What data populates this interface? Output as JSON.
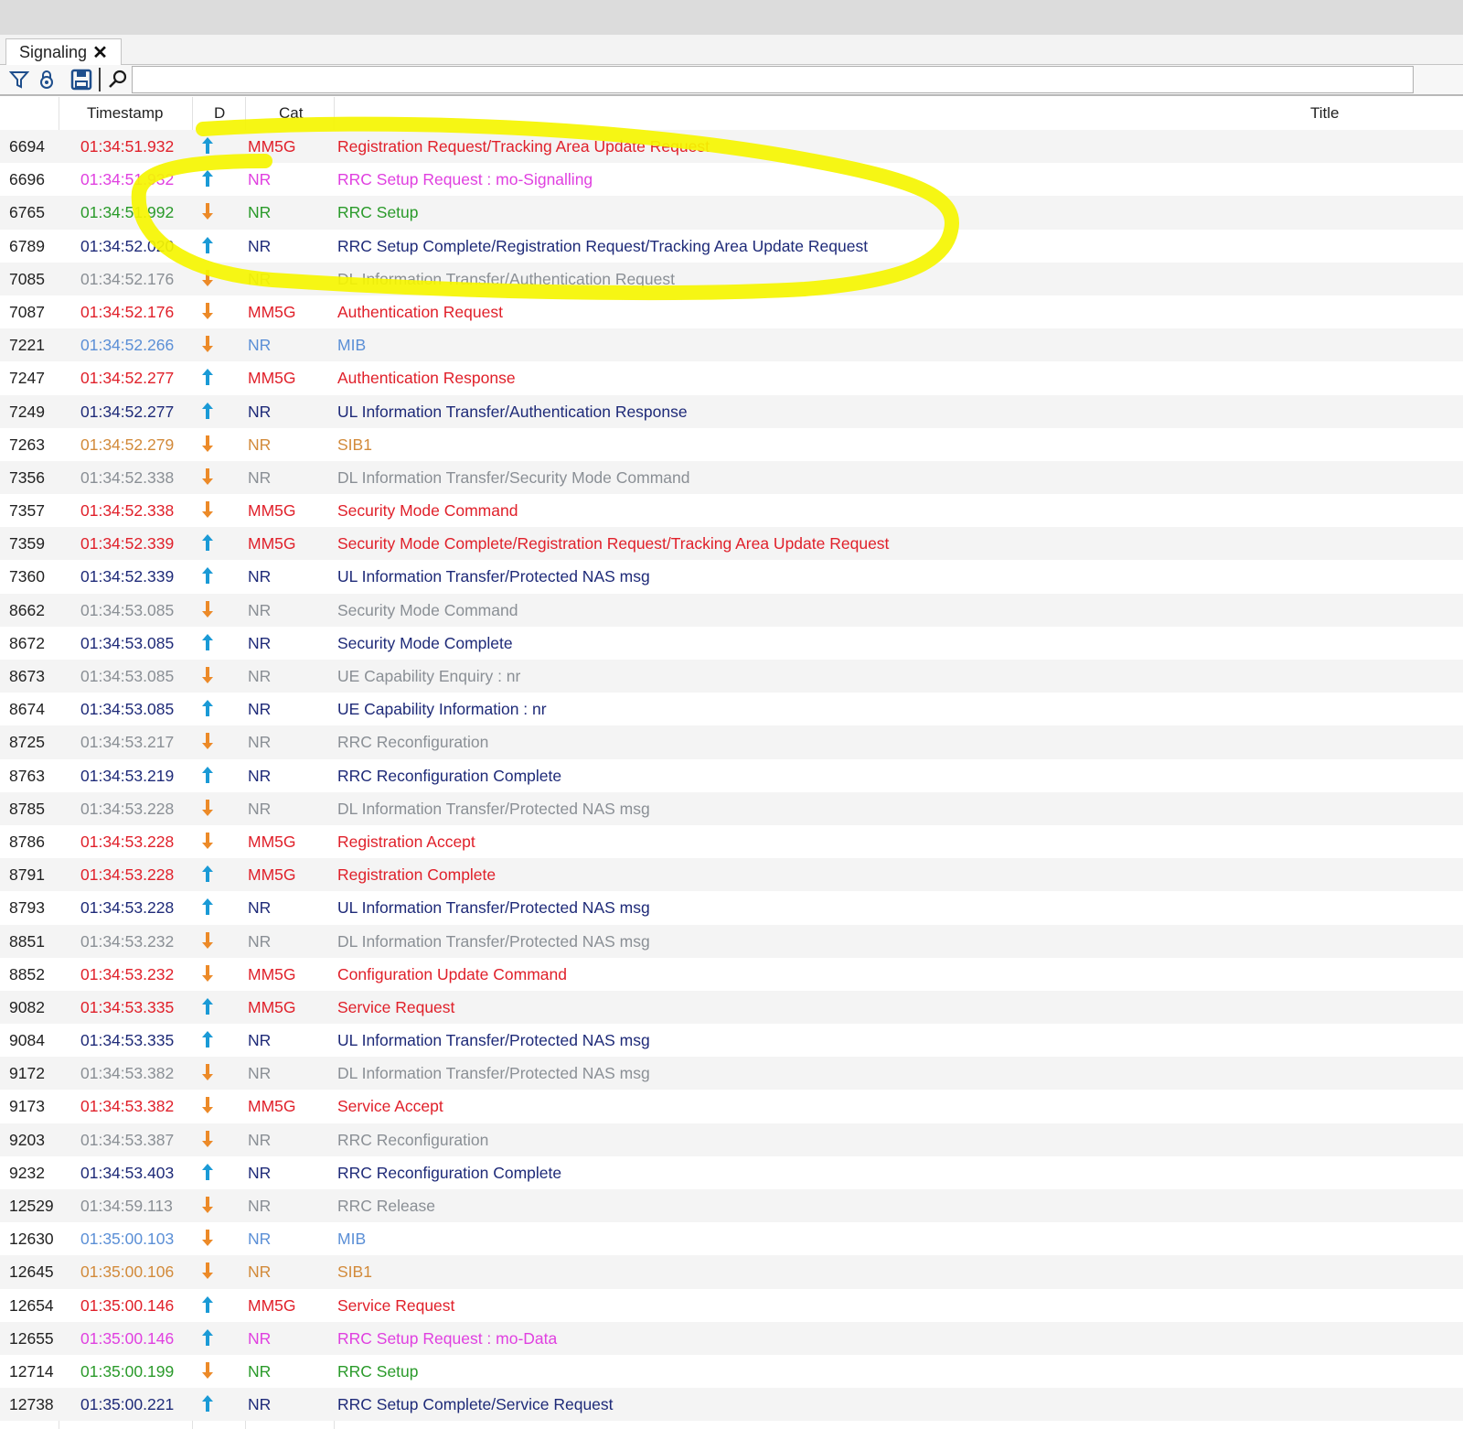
{
  "tab": {
    "label": "Signaling"
  },
  "icons": {
    "filter": "filter-icon",
    "lock": "lock-icon",
    "save": "save-icon",
    "search": "search-icon",
    "close": "close-icon"
  },
  "colors": {
    "red": "#e0202a",
    "magenta": "#e040e0",
    "green": "#2a9a2a",
    "navy": "#1e2a78",
    "gray": "#8a8f95",
    "blue": "#5b8fd6",
    "orange": "#d28a3a",
    "arrow_up": "#1a9ad6",
    "arrow_down": "#ec8a28",
    "highlight": "#f5f500"
  },
  "columns": {
    "timestamp": "Timestamp",
    "dir": "D",
    "cat": "Cat",
    "title": "Title"
  },
  "rows": [
    {
      "id": "6694",
      "ts": "01:34:51.932",
      "dir": "up",
      "cat": "MM5G",
      "title": "Registration Request/Tracking Area Update Request",
      "color": "red"
    },
    {
      "id": "6696",
      "ts": "01:34:51.932",
      "dir": "up",
      "cat": "NR",
      "title": "RRC Setup Request : mo-Signalling",
      "color": "mag"
    },
    {
      "id": "6765",
      "ts": "01:34:51.992",
      "dir": "down",
      "cat": "NR",
      "title": "RRC Setup",
      "color": "grn"
    },
    {
      "id": "6789",
      "ts": "01:34:52.020",
      "dir": "up",
      "cat": "NR",
      "title": "RRC Setup Complete/Registration Request/Tracking Area Update Request",
      "color": "nav"
    },
    {
      "id": "7085",
      "ts": "01:34:52.176",
      "dir": "down",
      "cat": "NR",
      "title": "DL Information Transfer/Authentication Request",
      "color": "gry"
    },
    {
      "id": "7087",
      "ts": "01:34:52.176",
      "dir": "down",
      "cat": "MM5G",
      "title": "Authentication Request",
      "color": "red"
    },
    {
      "id": "7221",
      "ts": "01:34:52.266",
      "dir": "down",
      "cat": "NR",
      "title": "MIB",
      "color": "blu"
    },
    {
      "id": "7247",
      "ts": "01:34:52.277",
      "dir": "up",
      "cat": "MM5G",
      "title": "Authentication Response",
      "color": "red"
    },
    {
      "id": "7249",
      "ts": "01:34:52.277",
      "dir": "up",
      "cat": "NR",
      "title": "UL Information Transfer/Authentication Response",
      "color": "nav"
    },
    {
      "id": "7263",
      "ts": "01:34:52.279",
      "dir": "down",
      "cat": "NR",
      "title": "SIB1",
      "color": "org"
    },
    {
      "id": "7356",
      "ts": "01:34:52.338",
      "dir": "down",
      "cat": "NR",
      "title": "DL Information Transfer/Security Mode Command",
      "color": "gry"
    },
    {
      "id": "7357",
      "ts": "01:34:52.338",
      "dir": "down",
      "cat": "MM5G",
      "title": "Security Mode Command",
      "color": "red"
    },
    {
      "id": "7359",
      "ts": "01:34:52.339",
      "dir": "up",
      "cat": "MM5G",
      "title": "Security Mode Complete/Registration Request/Tracking Area Update Request",
      "color": "red"
    },
    {
      "id": "7360",
      "ts": "01:34:52.339",
      "dir": "up",
      "cat": "NR",
      "title": "UL Information Transfer/Protected NAS msg",
      "color": "nav"
    },
    {
      "id": "8662",
      "ts": "01:34:53.085",
      "dir": "down",
      "cat": "NR",
      "title": "Security Mode Command",
      "color": "gry"
    },
    {
      "id": "8672",
      "ts": "01:34:53.085",
      "dir": "up",
      "cat": "NR",
      "title": "Security Mode Complete",
      "color": "nav"
    },
    {
      "id": "8673",
      "ts": "01:34:53.085",
      "dir": "down",
      "cat": "NR",
      "title": "UE Capability Enquiry : nr",
      "color": "gry"
    },
    {
      "id": "8674",
      "ts": "01:34:53.085",
      "dir": "up",
      "cat": "NR",
      "title": "UE Capability Information : nr",
      "color": "nav"
    },
    {
      "id": "8725",
      "ts": "01:34:53.217",
      "dir": "down",
      "cat": "NR",
      "title": "RRC Reconfiguration",
      "color": "gry"
    },
    {
      "id": "8763",
      "ts": "01:34:53.219",
      "dir": "up",
      "cat": "NR",
      "title": "RRC Reconfiguration Complete",
      "color": "nav"
    },
    {
      "id": "8785",
      "ts": "01:34:53.228",
      "dir": "down",
      "cat": "NR",
      "title": "DL Information Transfer/Protected NAS msg",
      "color": "gry"
    },
    {
      "id": "8786",
      "ts": "01:34:53.228",
      "dir": "down",
      "cat": "MM5G",
      "title": "Registration Accept",
      "color": "red"
    },
    {
      "id": "8791",
      "ts": "01:34:53.228",
      "dir": "up",
      "cat": "MM5G",
      "title": "Registration Complete",
      "color": "red"
    },
    {
      "id": "8793",
      "ts": "01:34:53.228",
      "dir": "up",
      "cat": "NR",
      "title": "UL Information Transfer/Protected NAS msg",
      "color": "nav"
    },
    {
      "id": "8851",
      "ts": "01:34:53.232",
      "dir": "down",
      "cat": "NR",
      "title": "DL Information Transfer/Protected NAS msg",
      "color": "gry"
    },
    {
      "id": "8852",
      "ts": "01:34:53.232",
      "dir": "down",
      "cat": "MM5G",
      "title": "Configuration Update Command",
      "color": "red"
    },
    {
      "id": "9082",
      "ts": "01:34:53.335",
      "dir": "up",
      "cat": "MM5G",
      "title": "Service Request",
      "color": "red"
    },
    {
      "id": "9084",
      "ts": "01:34:53.335",
      "dir": "up",
      "cat": "NR",
      "title": "UL Information Transfer/Protected NAS msg",
      "color": "nav"
    },
    {
      "id": "9172",
      "ts": "01:34:53.382",
      "dir": "down",
      "cat": "NR",
      "title": "DL Information Transfer/Protected NAS msg",
      "color": "gry"
    },
    {
      "id": "9173",
      "ts": "01:34:53.382",
      "dir": "down",
      "cat": "MM5G",
      "title": "Service Accept",
      "color": "red"
    },
    {
      "id": "9203",
      "ts": "01:34:53.387",
      "dir": "down",
      "cat": "NR",
      "title": "RRC Reconfiguration",
      "color": "gry"
    },
    {
      "id": "9232",
      "ts": "01:34:53.403",
      "dir": "up",
      "cat": "NR",
      "title": "RRC Reconfiguration Complete",
      "color": "nav"
    },
    {
      "id": "12529",
      "ts": "01:34:59.113",
      "dir": "down",
      "cat": "NR",
      "title": "RRC Release",
      "color": "gry"
    },
    {
      "id": "12630",
      "ts": "01:35:00.103",
      "dir": "down",
      "cat": "NR",
      "title": "MIB",
      "color": "blu"
    },
    {
      "id": "12645",
      "ts": "01:35:00.106",
      "dir": "down",
      "cat": "NR",
      "title": "SIB1",
      "color": "org"
    },
    {
      "id": "12654",
      "ts": "01:35:00.146",
      "dir": "up",
      "cat": "MM5G",
      "title": "Service Request",
      "color": "red"
    },
    {
      "id": "12655",
      "ts": "01:35:00.146",
      "dir": "up",
      "cat": "NR",
      "title": "RRC Setup Request : mo-Data",
      "color": "mag"
    },
    {
      "id": "12714",
      "ts": "01:35:00.199",
      "dir": "down",
      "cat": "NR",
      "title": "RRC Setup",
      "color": "grn"
    },
    {
      "id": "12738",
      "ts": "01:35:00.221",
      "dir": "up",
      "cat": "NR",
      "title": "RRC Setup Complete/Service Request",
      "color": "nav"
    }
  ]
}
